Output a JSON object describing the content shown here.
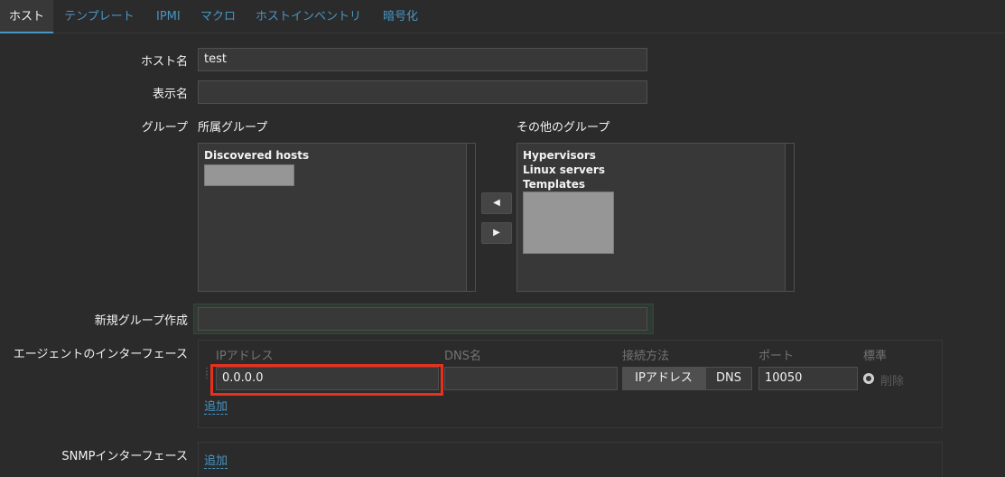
{
  "tabs": [
    {
      "label": "ホスト",
      "active": true
    },
    {
      "label": "テンプレート"
    },
    {
      "label": "IPMI"
    },
    {
      "label": "マクロ"
    },
    {
      "label": "ホストインベントリ"
    },
    {
      "label": "暗号化"
    }
  ],
  "form": {
    "host_name_label": "ホスト名",
    "host_name_value": "test",
    "display_name_label": "表示名",
    "display_name_value": "",
    "groups_label": "グループ",
    "in_groups_label": "所属グループ",
    "other_groups_label": "その他のグループ",
    "in_groups": [
      "Discovered hosts"
    ],
    "other_groups": [
      "Hypervisors",
      "Linux servers",
      "Templates"
    ],
    "new_group_label": "新規グループ作成",
    "new_group_value": ""
  },
  "agent_interface": {
    "label": "エージェントのインターフェース",
    "col_ip": "IPアドレス",
    "col_dns": "DNS名",
    "col_connect": "接続方法",
    "col_port": "ポート",
    "col_default": "標準",
    "ip_value": "0.0.0.0",
    "dns_value": "",
    "connect_ip": "IPアドレス",
    "connect_dns": "DNS",
    "connect_selected": "IPアドレス",
    "port_value": "10050",
    "remove_label": "削除",
    "add_label": "追加"
  },
  "snmp_interface": {
    "label": "SNMPインターフェース",
    "add_label": "追加"
  },
  "colors": {
    "background": "#2b2b2b",
    "accent": "#4796c4",
    "highlight": "#e8301c"
  }
}
